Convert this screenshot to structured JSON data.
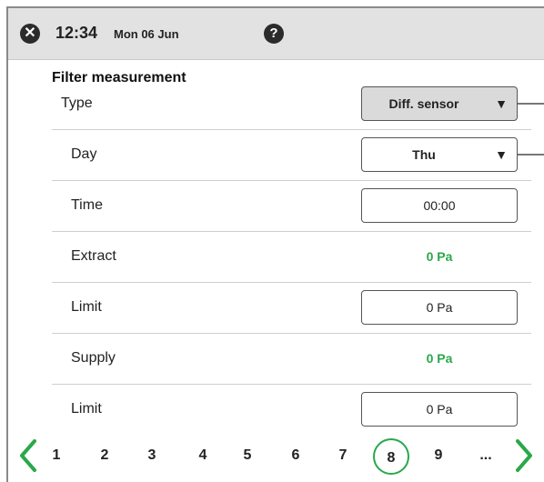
{
  "header": {
    "close_icon": "close-icon",
    "time": "12:34",
    "date": "Mon 06 Jun",
    "help_icon": "help-icon"
  },
  "section": {
    "title": "Filter measurement"
  },
  "rows": {
    "type": {
      "label": "Type",
      "value": "Diff. sensor"
    },
    "day": {
      "label": "Day",
      "value": "Thu"
    },
    "time": {
      "label": "Time",
      "value": "00:00"
    },
    "extract": {
      "label": "Extract",
      "value": "0 Pa"
    },
    "extract_limit": {
      "label": "Limit",
      "value": "0 Pa"
    },
    "supply": {
      "label": "Supply",
      "value": "0 Pa"
    },
    "supply_limit": {
      "label": "Limit",
      "value": "0 Pa"
    }
  },
  "pager": {
    "pages": [
      "1",
      "2",
      "3",
      "4",
      "5",
      "6",
      "7",
      "8",
      "9",
      "..."
    ],
    "current": "8"
  },
  "colors": {
    "accent_green": "#2aa84a",
    "topbar": "#e2e2e2",
    "select_disabled": "#dadada"
  }
}
